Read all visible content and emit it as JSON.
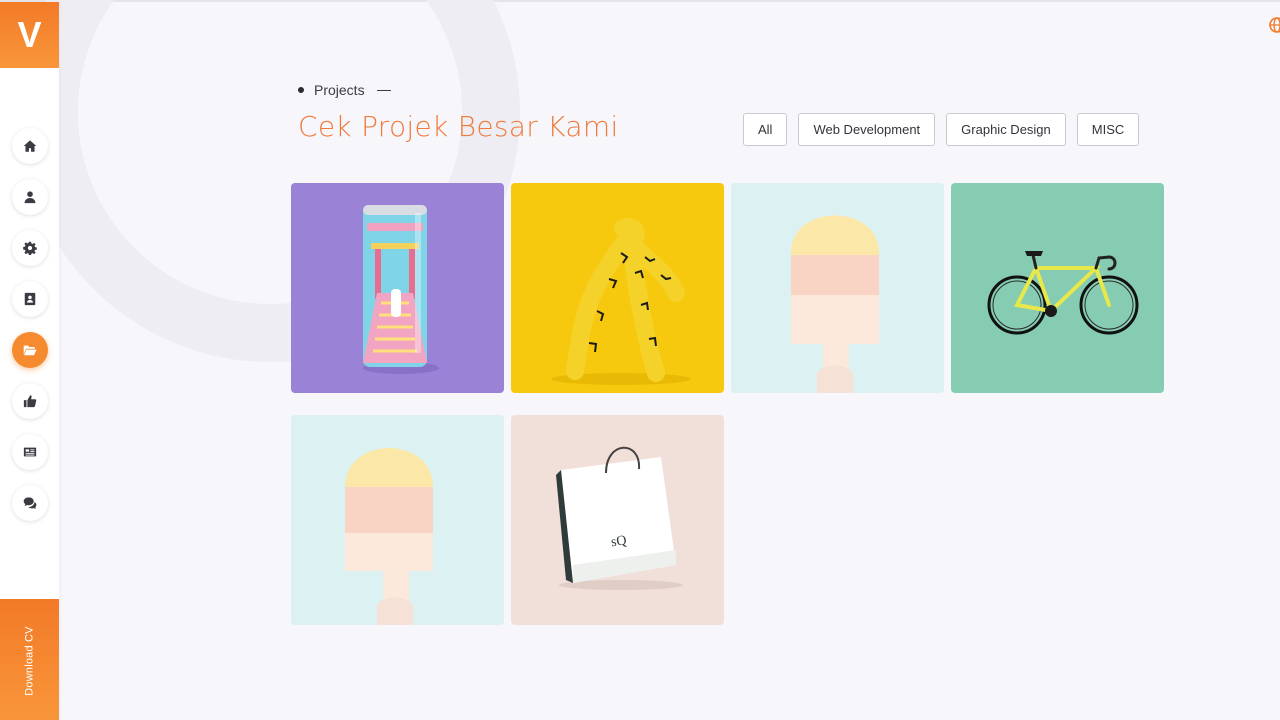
{
  "brand": {
    "logo_letter": "V"
  },
  "sidebar": {
    "items": [
      {
        "name": "home",
        "icon": "home-icon",
        "active": false
      },
      {
        "name": "about",
        "icon": "user-icon",
        "active": false
      },
      {
        "name": "services",
        "icon": "gear-icon",
        "active": false
      },
      {
        "name": "resume",
        "icon": "address-book-icon",
        "active": false
      },
      {
        "name": "projects",
        "icon": "folder-open-icon",
        "active": true
      },
      {
        "name": "testimonials",
        "icon": "thumbs-up-icon",
        "active": false
      },
      {
        "name": "blog",
        "icon": "newspaper-icon",
        "active": false
      },
      {
        "name": "contact",
        "icon": "comments-icon",
        "active": false
      }
    ],
    "download_label": "Download CV"
  },
  "header": {
    "subtitle": "Projects",
    "title": "Cek Projek Besar Kami"
  },
  "filters": [
    {
      "label": "All"
    },
    {
      "label": "Web Development"
    },
    {
      "label": "Graphic Design"
    },
    {
      "label": "MISC"
    }
  ],
  "projects": [
    {
      "thumbnail": "soda-can",
      "bg": "#9a82d6"
    },
    {
      "thumbnail": "yellow-abstract-figure",
      "bg": "#f7c90e"
    },
    {
      "thumbnail": "popsicle",
      "bg": "#dcf1f2"
    },
    {
      "thumbnail": "bicycle",
      "bg": "#86ccb3"
    },
    {
      "thumbnail": "popsicle",
      "bg": "#dcf1f2"
    },
    {
      "thumbnail": "shopping-bag",
      "bg": "#f1dfd9",
      "brand_text": "sQ"
    }
  ],
  "colors": {
    "accent": "#f37a27",
    "title": "#f07a3b",
    "background": "#f6f6fb"
  }
}
